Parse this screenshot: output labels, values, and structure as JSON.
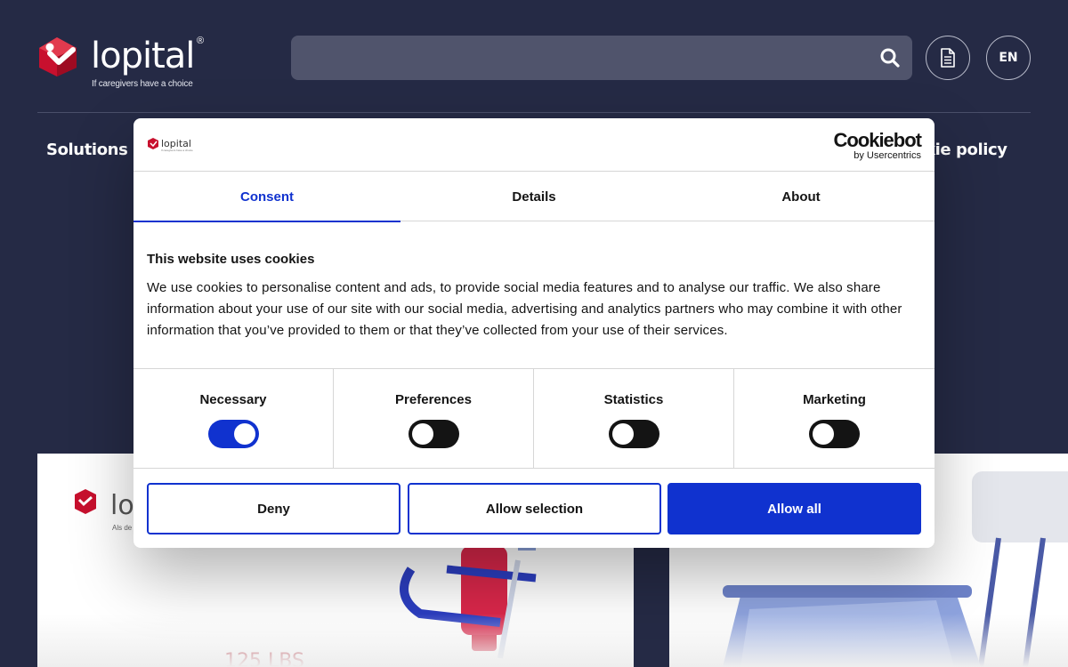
{
  "header": {
    "logo_text": "lopital",
    "logo_registered": "®",
    "tagline": "If caregivers have a choice",
    "search": {
      "value": "",
      "placeholder": ""
    },
    "icons": {
      "search": "search-icon",
      "document": "document-icon"
    },
    "language": "EN"
  },
  "nav": {
    "solutions": "Solutions",
    "cookie_policy": "kie policy"
  },
  "background_cards": {
    "left_logo_partial": "lo",
    "left_tagline_partial": "Als de z",
    "left_caption_partial": "125 LBS"
  },
  "cookie_dialog": {
    "brand_name": "Cookiebot",
    "brand_sub": "by Usercentrics",
    "tabs": [
      {
        "label": "Consent",
        "active": true
      },
      {
        "label": "Details",
        "active": false
      },
      {
        "label": "About",
        "active": false
      }
    ],
    "title": "This website uses cookies",
    "text": "We use cookies to personalise content and ads, to provide social media features and to analyse our traffic. We also share information about your use of our site with our social media, advertising and analytics partners who may combine it with other information that you’ve provided to them or that they’ve collected from your use of their services.",
    "categories": [
      {
        "label": "Necessary",
        "enabled": true
      },
      {
        "label": "Preferences",
        "enabled": false
      },
      {
        "label": "Statistics",
        "enabled": false
      },
      {
        "label": "Marketing",
        "enabled": false
      }
    ],
    "buttons": {
      "deny": "Deny",
      "allow_selection": "Allow selection",
      "allow_all": "Allow all"
    }
  },
  "colors": {
    "page_bg": "#252a45",
    "accent_blue": "#1032cf",
    "brand_red": "#c8102e",
    "search_bg": "#50546c"
  }
}
